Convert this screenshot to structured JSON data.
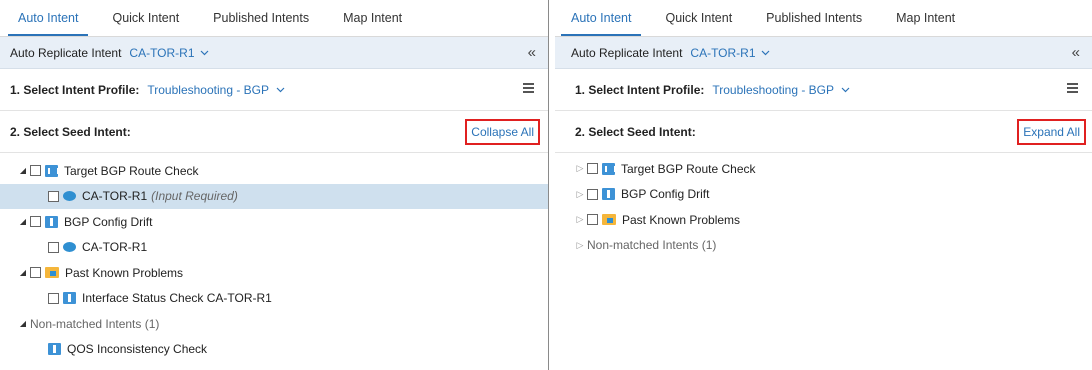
{
  "left": {
    "tabs": [
      {
        "label": "Auto Intent",
        "active": true
      },
      {
        "label": "Quick Intent",
        "active": false
      },
      {
        "label": "Published Intents",
        "active": false
      },
      {
        "label": "Map Intent",
        "active": false
      }
    ],
    "replicate": {
      "label": "Auto Replicate Intent",
      "device": "CA-TOR-R1"
    },
    "profile": {
      "label": "1. Select Intent Profile:",
      "value": "Troubleshooting - BGP"
    },
    "seed": {
      "label": "2. Select Seed Intent:",
      "button": "Collapse All"
    },
    "tree": {
      "g1": "Target BGP Route Check",
      "g1_child": "CA-TOR-R1",
      "g1_child_hint": "(Input Required)",
      "g2": "BGP Config Drift",
      "g2_child": "CA-TOR-R1",
      "g3": "Past Known Problems",
      "g3_child": "Interface Status Check CA-TOR-R1",
      "g4": "Non-matched Intents (1)",
      "g4_child": "QOS Inconsistency Check"
    }
  },
  "right": {
    "tabs": [
      {
        "label": "Auto Intent",
        "active": true
      },
      {
        "label": "Quick Intent",
        "active": false
      },
      {
        "label": "Published Intents",
        "active": false
      },
      {
        "label": "Map Intent",
        "active": false
      }
    ],
    "replicate": {
      "label": "Auto Replicate Intent",
      "device": "CA-TOR-R1"
    },
    "profile": {
      "label": "1. Select Intent Profile:",
      "value": "Troubleshooting - BGP"
    },
    "seed": {
      "label": "2. Select Seed Intent:",
      "button": "Expand All"
    },
    "tree": {
      "g1": "Target BGP Route Check",
      "g2": "BGP Config Drift",
      "g3": "Past Known Problems",
      "g4": "Non-matched Intents (1)"
    }
  },
  "colors": {
    "accent": "#2b73b8",
    "highlight_border": "#e02020",
    "selected_row": "#cfe0ee",
    "header_band": "#e8eff7"
  }
}
